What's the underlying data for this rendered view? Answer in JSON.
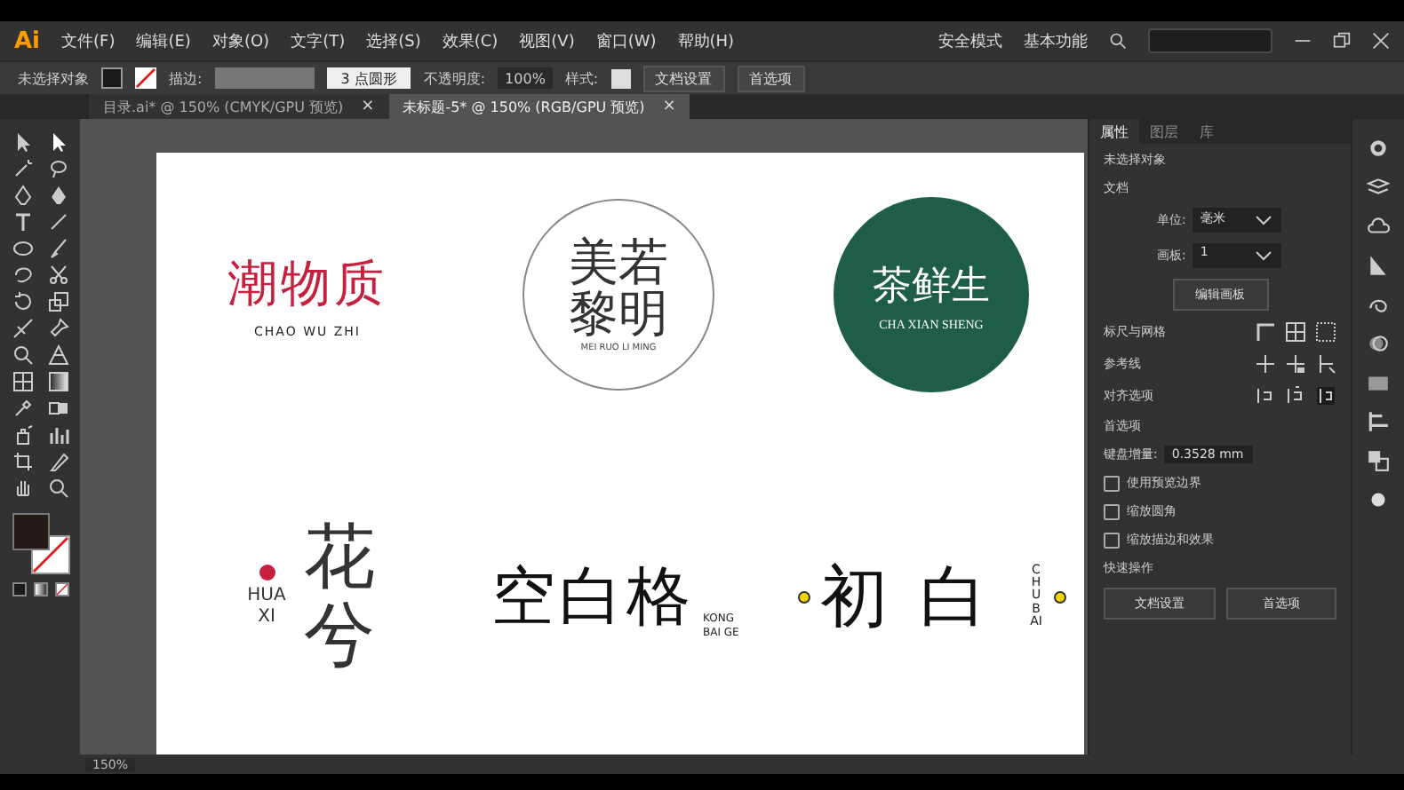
{
  "menu_bar": {
    "app_logo": "Ai",
    "menus": [
      "文件(F)",
      "编辑(E)",
      "对象(O)",
      "文字(T)",
      "选择(S)",
      "效果(C)",
      "视图(V)",
      "窗口(W)",
      "帮助(H)"
    ],
    "workspace_items": [
      "安全模式",
      "基本功能"
    ]
  },
  "control_bar": {
    "selection": "未选择对象",
    "stroke_label": "描边:",
    "brush": "3 点圆形",
    "opacity_label": "不透明度:",
    "opacity": "100%",
    "style_label": "样式:",
    "buttons": [
      "文档设置",
      "首选项"
    ]
  },
  "document_tabs": [
    {
      "title": "目录.ai* @ 150% (CMYK/GPU 预览)",
      "close": "×",
      "selected": false
    },
    {
      "title": "未标题-5* @ 150% (RGB/GPU 预览)",
      "close": "×",
      "selected": true
    }
  ],
  "artboard": {
    "logos": [
      {
        "kind": "below",
        "title": "潮物质",
        "subtitle": "CHAO WU ZHI"
      },
      {
        "kind": "ring",
        "title": "美若黎明",
        "subtitle": "MEI RUO LI MING"
      },
      {
        "kind": "badge",
        "title": "茶鲜生",
        "subtitle": "CHA XIAN SHENG"
      },
      {
        "kind": "left",
        "title": "花兮",
        "subtitle": "HUA XI"
      },
      {
        "kind": "right",
        "title": "空白格",
        "subtitle": "KONG BAI GE"
      },
      {
        "kind": "middle",
        "title": "初白",
        "subtitle": "CHUBAI"
      }
    ]
  },
  "properties_panel": {
    "tabs": [
      {
        "label": "属性",
        "selected": true
      },
      {
        "label": "图层",
        "selected": false
      },
      {
        "label": "库",
        "selected": false
      }
    ],
    "selection": "未选择对象",
    "document_heading": "文档",
    "unit_label": "单位:",
    "unit": "毫米",
    "artboard_label": "画板:",
    "artboard": "1",
    "edit_artboards": "编辑画板",
    "rows": [
      "标尺与网格",
      "参考线",
      "对齐选项"
    ],
    "preferences_heading": "首选项",
    "increment_label": "键盘增量:",
    "increment": "0.3528 mm",
    "options": [
      {
        "label": "使用预览边界",
        "checked": false
      },
      {
        "label": "缩放圆角",
        "checked": false
      },
      {
        "label": "缩放描边和效果",
        "checked": false
      }
    ],
    "quick_actions_heading": "快速操作",
    "quick_actions": [
      "文档设置",
      "首选项"
    ]
  },
  "status_bar": {
    "zoom": "150%"
  }
}
